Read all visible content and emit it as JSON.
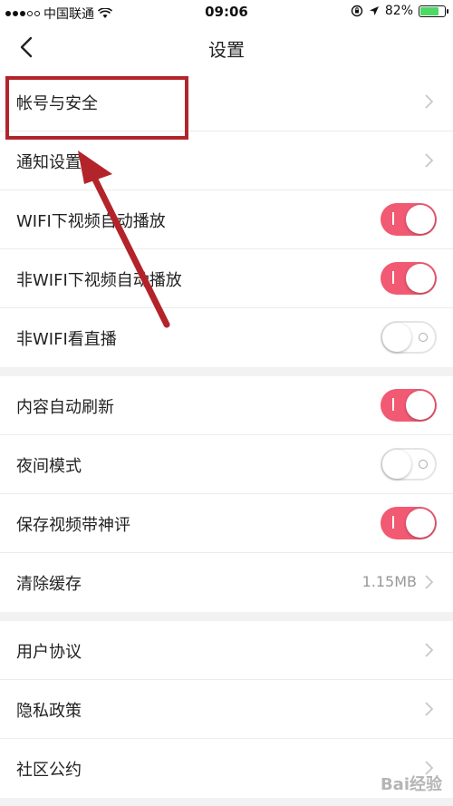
{
  "status_bar": {
    "carrier": "中国联通",
    "time": "09:06",
    "battery_text": "82%",
    "battery_level": 0.82
  },
  "nav": {
    "title": "设置"
  },
  "groups": [
    {
      "rows": [
        {
          "label": "帐号与安全",
          "type": "chevron"
        },
        {
          "label": "通知设置",
          "type": "chevron"
        },
        {
          "label": "WIFI下视频自动播放",
          "type": "toggle",
          "on": true
        },
        {
          "label": "非WIFI下视频自动播放",
          "type": "toggle",
          "on": true
        },
        {
          "label": "非WIFI看直播",
          "type": "toggle",
          "on": false
        }
      ]
    },
    {
      "rows": [
        {
          "label": "内容自动刷新",
          "type": "toggle",
          "on": true
        },
        {
          "label": "夜间模式",
          "type": "toggle",
          "on": false
        },
        {
          "label": "保存视频带神评",
          "type": "toggle",
          "on": true
        },
        {
          "label": "清除缓存",
          "type": "value",
          "value": "1.15MB"
        }
      ]
    },
    {
      "rows": [
        {
          "label": "用户协议",
          "type": "chevron"
        },
        {
          "label": "隐私政策",
          "type": "chevron"
        },
        {
          "label": "社区公约",
          "type": "chevron"
        }
      ]
    }
  ],
  "colors": {
    "toggle_on": "#f15a72",
    "annotation": "#b3242a"
  },
  "watermark": "Bai经验"
}
